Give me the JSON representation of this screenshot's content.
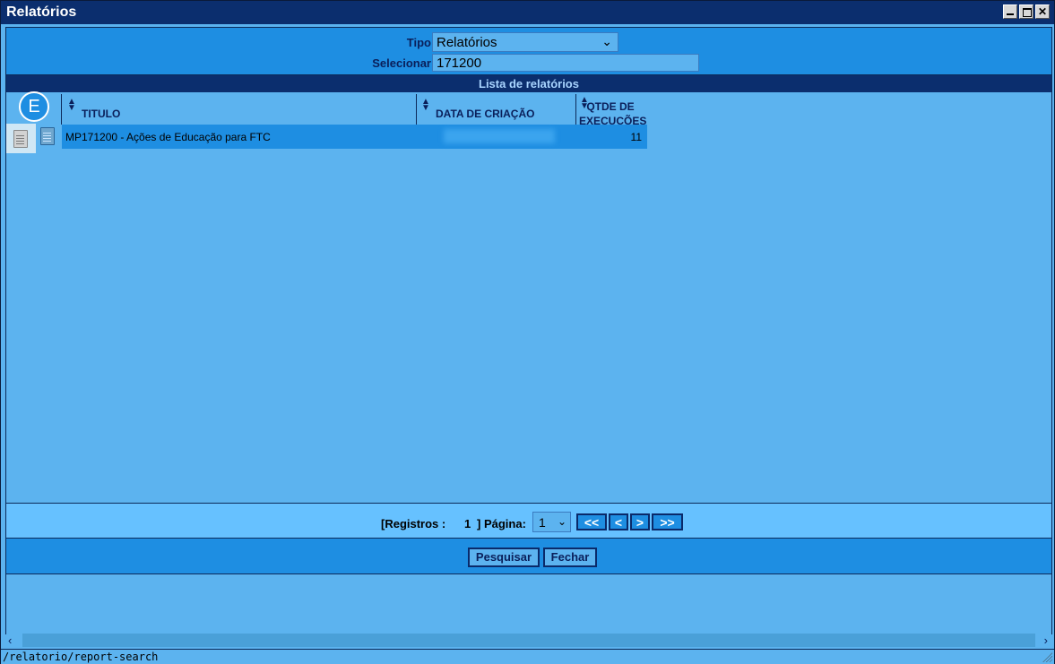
{
  "window": {
    "title": "Relatórios"
  },
  "filter": {
    "tipo_label": "Tipo",
    "tipo_value": "Relatórios",
    "selecionar_label": "Selecionar",
    "selecionar_value": "171200"
  },
  "list": {
    "header": "Lista de relatórios",
    "badge": "E",
    "columns": {
      "title": "TITULO",
      "date": "DATA DE CRIAÇÃO",
      "qtde": "QTDE DE EXECUÇÕES"
    },
    "rows": [
      {
        "title": "MP171200 - Ações de Educação para FTC",
        "qtde": "11"
      }
    ]
  },
  "pager": {
    "registros_label": "[Registros :",
    "registros_count": "1",
    "pagina_label": "] Página:",
    "page_value": "1",
    "first": "<<",
    "prev": "<",
    "next": ">",
    "last": ">>"
  },
  "actions": {
    "search": "Pesquisar",
    "close": "Fechar"
  },
  "statusbar": {
    "path": "/relatorio/report-search"
  },
  "colors": {
    "titlebar": "#0b2e6e",
    "panel": "#1e8ee2",
    "background": "#5cb3ef",
    "pager": "#66c1ff"
  }
}
